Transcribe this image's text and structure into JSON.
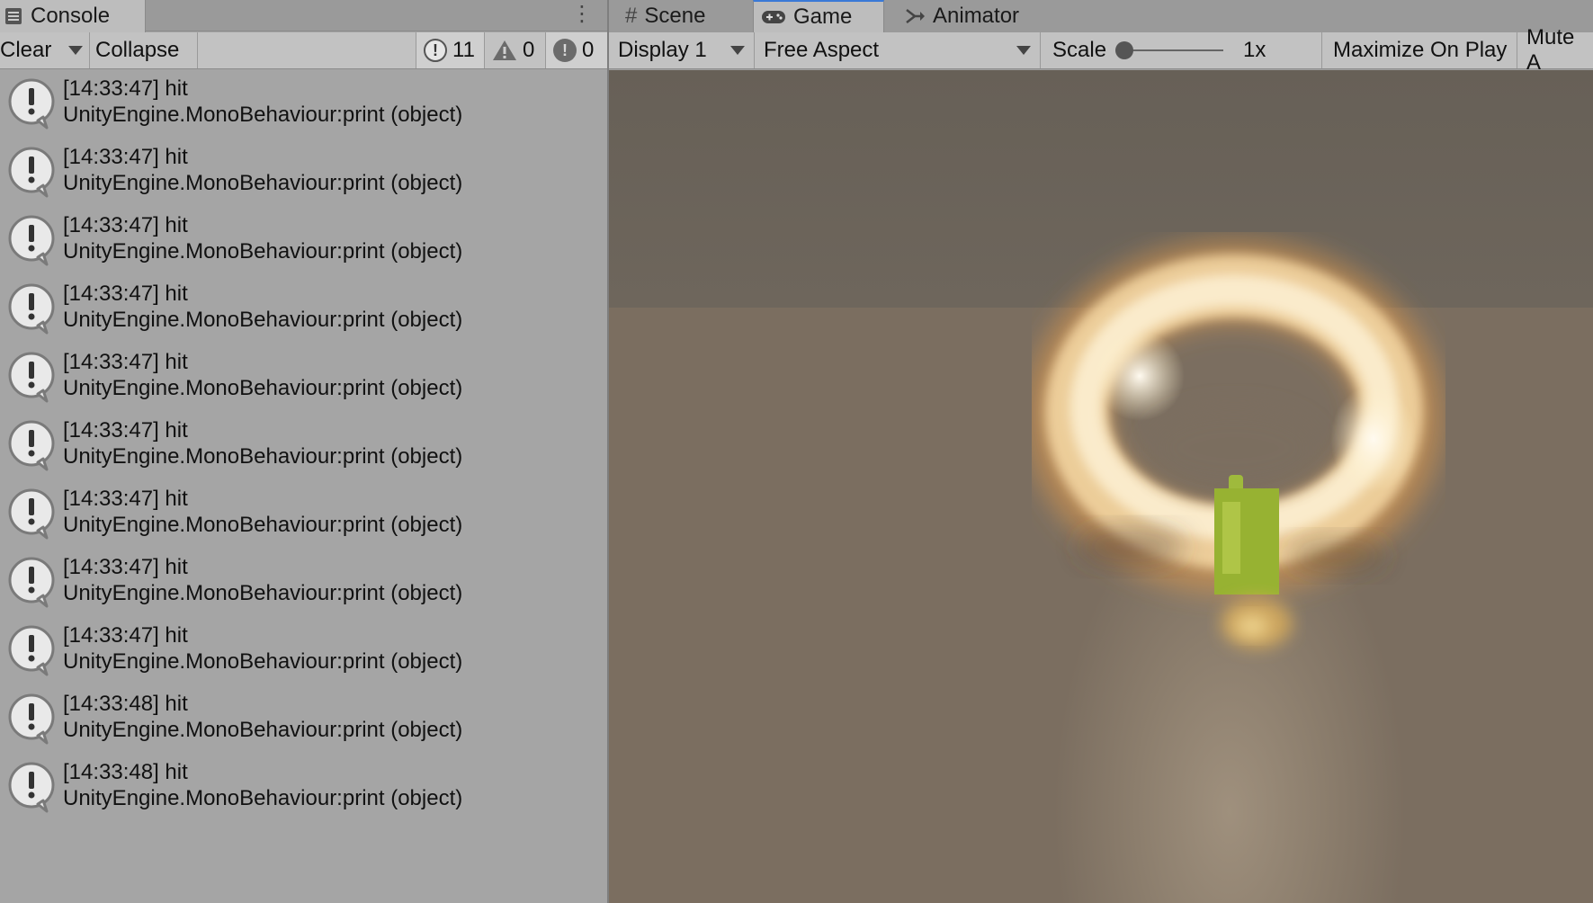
{
  "console": {
    "tab_label": "Console",
    "toolbar": {
      "clear_label": "Clear",
      "collapse_label": "Collapse",
      "log_count": "11",
      "warning_count": "0",
      "error_count": "0"
    },
    "entries": [
      {
        "line1": "[14:33:47] hit",
        "line2": "UnityEngine.MonoBehaviour:print (object)"
      },
      {
        "line1": "[14:33:47] hit",
        "line2": "UnityEngine.MonoBehaviour:print (object)"
      },
      {
        "line1": "[14:33:47] hit",
        "line2": "UnityEngine.MonoBehaviour:print (object)"
      },
      {
        "line1": "[14:33:47] hit",
        "line2": "UnityEngine.MonoBehaviour:print (object)"
      },
      {
        "line1": "[14:33:47] hit",
        "line2": "UnityEngine.MonoBehaviour:print (object)"
      },
      {
        "line1": "[14:33:47] hit",
        "line2": "UnityEngine.MonoBehaviour:print (object)"
      },
      {
        "line1": "[14:33:47] hit",
        "line2": "UnityEngine.MonoBehaviour:print (object)"
      },
      {
        "line1": "[14:33:47] hit",
        "line2": "UnityEngine.MonoBehaviour:print (object)"
      },
      {
        "line1": "[14:33:47] hit",
        "line2": "UnityEngine.MonoBehaviour:print (object)"
      },
      {
        "line1": "[14:33:48] hit",
        "line2": "UnityEngine.MonoBehaviour:print (object)"
      },
      {
        "line1": "[14:33:48] hit",
        "line2": "UnityEngine.MonoBehaviour:print (object)"
      }
    ]
  },
  "view_tabs": {
    "scene_label": "Scene",
    "game_label": "Game",
    "animator_label": "Animator",
    "active": "Game"
  },
  "game_toolbar": {
    "display_value": "Display 1",
    "aspect_value": "Free Aspect",
    "scale_label": "Scale",
    "scale_value": "1x",
    "maximize_label": "Maximize On Play",
    "mute_label": "Mute A"
  },
  "colors": {
    "active_tab_accent": "#3a79d6",
    "fire_core": "#fff6d8",
    "fire_outer": "#e8a040",
    "object_green": "#a6c23a"
  }
}
